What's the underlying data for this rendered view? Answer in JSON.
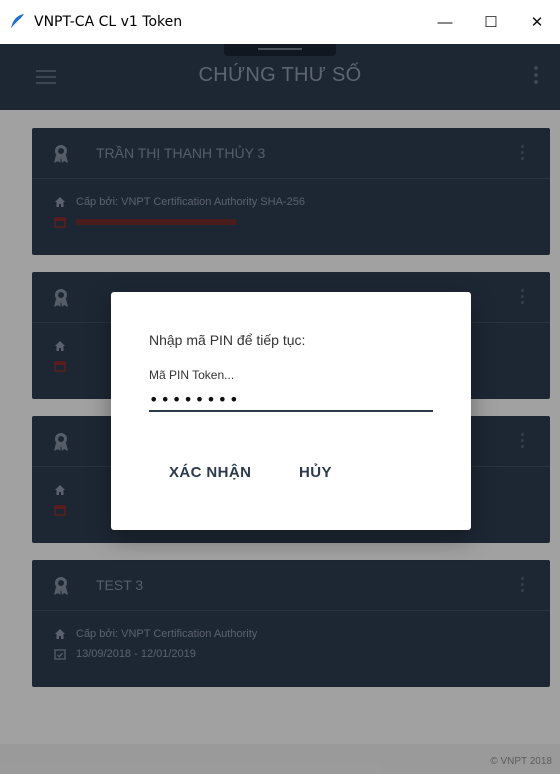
{
  "window": {
    "title": "VNPT-CA CL v1 Token",
    "minimize": "—",
    "maximize": "☐",
    "close": "✕"
  },
  "appbar": {
    "title": "CHỨNG THƯ SỐ"
  },
  "certificates": [
    {
      "name": "TRẦN THỊ THANH THỦY 3",
      "issuer": "Cấp bởi: VNPT Certification Authority SHA-256",
      "date": "",
      "date_status": "expired"
    },
    {
      "name": "",
      "issuer": "",
      "date": "",
      "date_status": "expired"
    },
    {
      "name": "",
      "issuer": "",
      "date": "",
      "date_status": "expired"
    },
    {
      "name": "TEST 3",
      "issuer": "Cấp bởi: VNPT Certification Authority",
      "date": "13/09/2018 - 12/01/2019",
      "date_status": "valid"
    }
  ],
  "footer": {
    "copyright": "© VNPT 2018"
  },
  "dialog": {
    "title": "Nhập mã PIN để tiếp tục:",
    "pin_label": "Mã PIN Token...",
    "pin_value": "••••••••",
    "confirm_label": "XÁC NHẬN",
    "cancel_label": "HỦY"
  },
  "colors": {
    "primary": "#2b3a4d",
    "expired_date": "#8a2a2a",
    "app_background": "#eeeeee",
    "logo": "#1f6fd1"
  }
}
